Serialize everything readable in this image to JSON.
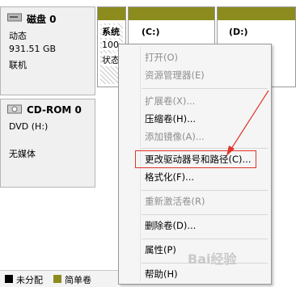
{
  "disk0": {
    "title": "磁盘 0",
    "type": "动态",
    "size": "931.51 GB",
    "status": "联机"
  },
  "partitions": {
    "system_title": "系统",
    "system_size_partial": "100",
    "system_status_partial": "状态",
    "c_title": "(C:)",
    "d_title": "(D:)"
  },
  "cdrom": {
    "title": "CD-ROM 0",
    "drive": "DVD (H:)",
    "media": "无媒体"
  },
  "context_menu": {
    "open": "打开(O)",
    "explore": "资源管理器(E)",
    "extend": "扩展卷(X)...",
    "shrink": "压缩卷(H)...",
    "add_mirror": "添加镜像(A)...",
    "change_letter": "更改驱动器号和路径(C)...",
    "format": "格式化(F)...",
    "reactivate": "重新激活卷(R)",
    "delete": "删除卷(D)...",
    "properties": "属性(P)",
    "help": "帮助(H)"
  },
  "legend": {
    "unallocated": "未分配",
    "simple": "简单卷"
  },
  "watermark": "Bai经验",
  "colors": {
    "partition_bar": "#8b8b1e",
    "highlight_box": "#e0352b",
    "arrow": "#e0352b"
  }
}
